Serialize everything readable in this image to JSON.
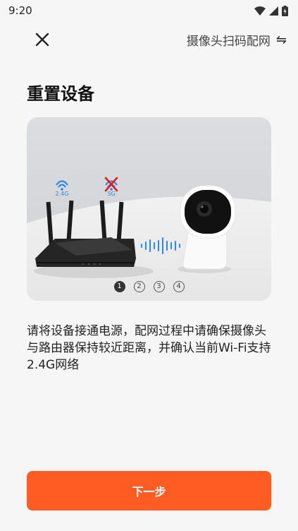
{
  "status_bar": {
    "time": "9:20",
    "icons": [
      "wifi-icon",
      "signal-icon",
      "battery-charging-icon"
    ]
  },
  "header": {
    "close_icon": "close-icon",
    "mode_label": "摄像头扫码配网",
    "switch_icon": "swap-arrows-icon"
  },
  "page_title": "重置设备",
  "illustration": {
    "router_labels": [
      "2.4G",
      "5G"
    ],
    "steps": [
      "1",
      "2",
      "3",
      "4"
    ],
    "active_step": 1
  },
  "description": "请将设备接通电源，配网过程中请确保摄像头与路由器保持较近距离，并确认当前Wi-Fi支持2.4G网络",
  "next_button_label": "下一步",
  "colors": {
    "accent": "#ff5c23",
    "background": "#f6f6f6",
    "wifi_blue": "#2e86e6",
    "error_red": "#e02020"
  }
}
